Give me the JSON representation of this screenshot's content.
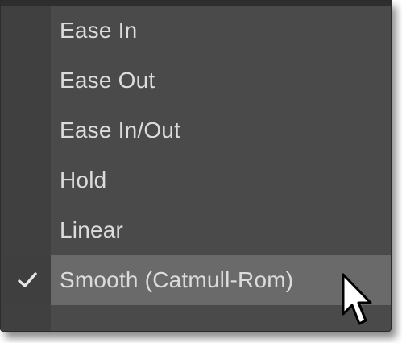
{
  "menu": {
    "items": [
      {
        "label": "Ease In",
        "selected": false
      },
      {
        "label": "Ease Out",
        "selected": false
      },
      {
        "label": "Ease In/Out",
        "selected": false
      },
      {
        "label": "Hold",
        "selected": false
      },
      {
        "label": "Linear",
        "selected": false
      },
      {
        "label": "Smooth (Catmull-Rom)",
        "selected": true
      }
    ]
  },
  "icons": {
    "check": "checkmark-icon",
    "cursor": "mouse-pointer-icon"
  },
  "colors": {
    "menu_background": "#4a4a4a",
    "gutter_background": "#404040",
    "highlight_background": "#6a6a6a",
    "text": "#dcdcdc"
  }
}
